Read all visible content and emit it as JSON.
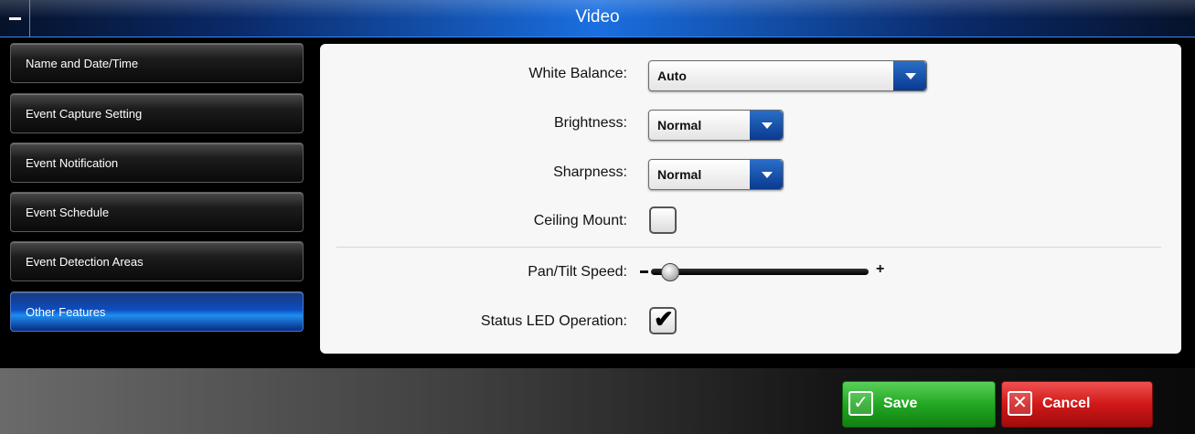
{
  "window": {
    "title": "Video"
  },
  "sidebar": {
    "items": [
      {
        "label": "Name and Date/Time",
        "active": false
      },
      {
        "label": "Event Capture Setting",
        "active": false
      },
      {
        "label": "Event Notification",
        "active": false
      },
      {
        "label": "Event Schedule",
        "active": false
      },
      {
        "label": "Event Detection Areas",
        "active": false
      },
      {
        "label": "Other Features",
        "active": true
      }
    ]
  },
  "settings": {
    "white_balance": {
      "label": "White Balance:",
      "value": "Auto"
    },
    "brightness": {
      "label": "Brightness:",
      "value": "Normal"
    },
    "sharpness": {
      "label": "Sharpness:",
      "value": "Normal"
    },
    "ceiling_mount": {
      "label": "Ceiling Mount:",
      "checked": false
    },
    "pan_tilt_speed": {
      "label": "Pan/Tilt Speed:",
      "minus": "−",
      "plus": "+",
      "level": 0.05
    },
    "status_led": {
      "label": "Status LED Operation:",
      "checked": true,
      "mark": "✔"
    }
  },
  "footer": {
    "save_label": "Save",
    "save_icon": "✓",
    "cancel_label": "Cancel",
    "cancel_icon": "✕"
  },
  "colors": {
    "accent_blue": "#1a6fe0",
    "save_green": "#22a822",
    "cancel_red": "#d01818"
  }
}
